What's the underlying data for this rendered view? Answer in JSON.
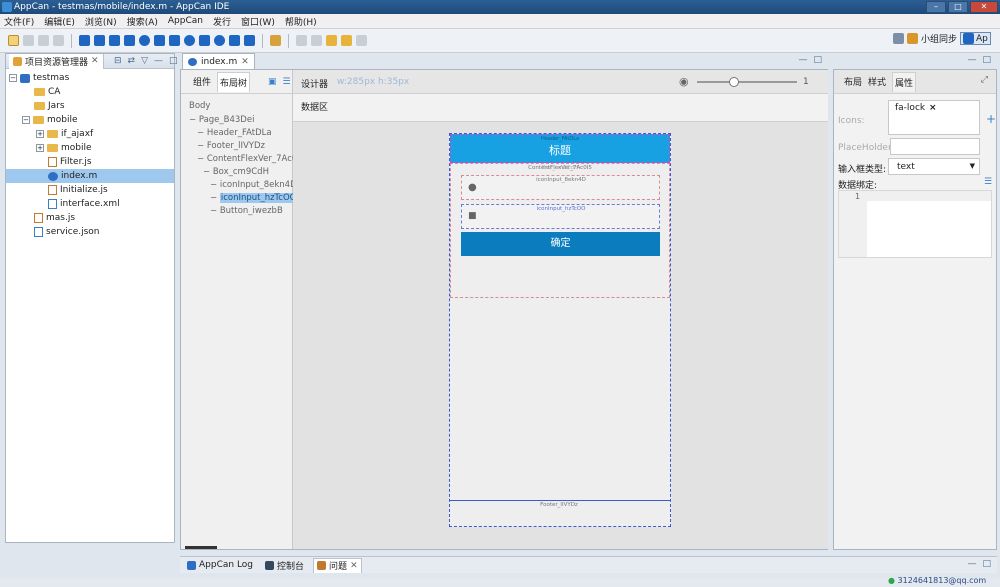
{
  "window": {
    "title": "AppCan - testmas/mobile/index.m - AppCan IDE"
  },
  "menu": [
    "文件(F)",
    "编辑(E)",
    "浏览(N)",
    "搜索(A)",
    "AppCan",
    "发行",
    "窗口(W)",
    "帮助(H)"
  ],
  "perspective": {
    "sync_label": "小组同步",
    "app_label": "Ap"
  },
  "project_explorer": {
    "tab_label": "项目资源管理器",
    "items": [
      {
        "label": "testmas"
      },
      {
        "label": "CA"
      },
      {
        "label": "Jars"
      },
      {
        "label": "mobile"
      },
      {
        "label": "if_ajaxf"
      },
      {
        "label": "mobile"
      },
      {
        "label": "Filter.js"
      },
      {
        "label": "index.m"
      },
      {
        "label": "Initialize.js"
      },
      {
        "label": "interface.xml"
      },
      {
        "label": "mas.js"
      },
      {
        "label": "service.json"
      }
    ]
  },
  "editor": {
    "tab_label": "index.m",
    "outline_tabs": [
      "组件",
      "布局树"
    ],
    "outline_nodes": [
      "Body",
      "Page_B43Dei",
      "Header_FAtDLa",
      "Footer_lIVYDz",
      "ContentFlexVer_7Ac0I5",
      "Box_cm9CdH",
      "iconInput_8ekn4D",
      "iconInput_hzTcOO",
      "Button_iwezbB"
    ],
    "designer_label": "设计器",
    "size_info": "w:285px h:35px",
    "zoom_value": "1",
    "data_zone_label": "数据区",
    "phone": {
      "header_caption": "Header_FAtDLa",
      "header_title": "标题",
      "content_caption": "ContentFlexVer_7Ac0I5",
      "box_caption": "Box_cm9CdH",
      "input1_caption": "iconInput_8ekn4D",
      "input2_caption": "iconInput_hzTcOO",
      "button_label": "确定",
      "footer_caption": "Footer_lIVYDz"
    }
  },
  "properties": {
    "tabs": [
      "布局",
      "样式",
      "属性"
    ],
    "icons_label": "Icons:",
    "icons_value": "fa-lock",
    "icons_remove": "×",
    "placeholder_label": "PlaceHolder:",
    "input_type_label": "输入框类型:",
    "input_type_value": "text",
    "data_binding_label": "数据绑定:",
    "line_number": "1"
  },
  "bottom": {
    "tabs": [
      "AppCan Log",
      "控制台",
      "问题"
    ]
  },
  "status": {
    "text": "3124641813@qq.com"
  },
  "colors": {
    "header_blue": "#17a1e3",
    "button_blue": "#0b7dbf",
    "selection": "#9fc8ef"
  }
}
